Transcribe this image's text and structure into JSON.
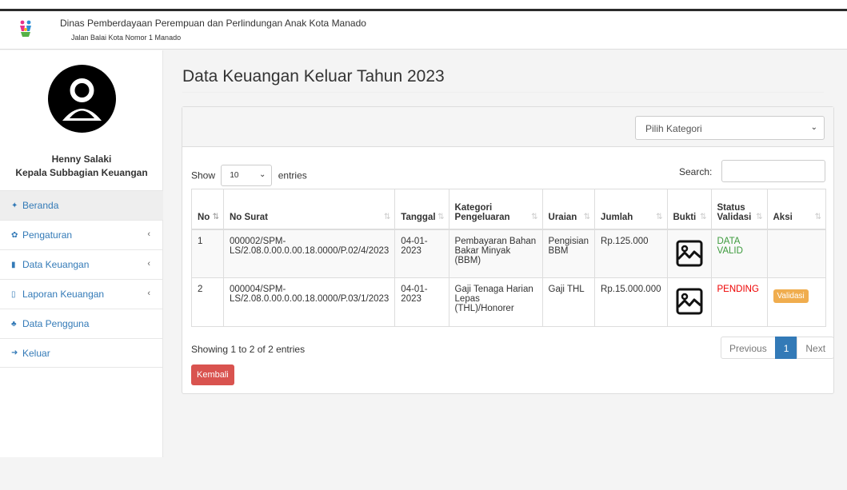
{
  "header": {
    "org_name": "Dinas Pemberdayaan Perempuan dan Perlindungan Anak Kota Manado",
    "org_address": "Jalan Balai Kota Nomor 1 Manado",
    "logo_icon": "dp3a-logo-icon"
  },
  "sidebar": {
    "user_name": "Henny Salaki",
    "user_role": "Kepala Subbagian Keuangan",
    "avatar_icon": "user-avatar-icon",
    "items": [
      {
        "icon": "home-icon",
        "glyph": "✦",
        "label": "Beranda",
        "has_submenu": false
      },
      {
        "icon": "gear-icon",
        "glyph": "✿",
        "label": "Pengaturan",
        "has_submenu": true
      },
      {
        "icon": "file-icon",
        "glyph": "▮",
        "label": "Data Keuangan",
        "has_submenu": true
      },
      {
        "icon": "report-icon",
        "glyph": "▯",
        "label": "Laporan Keuangan",
        "has_submenu": true
      },
      {
        "icon": "add-user-icon",
        "glyph": "♣",
        "label": "Data Pengguna",
        "has_submenu": false
      },
      {
        "icon": "sign-out-icon",
        "glyph": "➜",
        "label": "Keluar",
        "has_submenu": false
      }
    ]
  },
  "main": {
    "title": "Data Keuangan Keluar Tahun 2023",
    "category_select": {
      "selected": "Pilih Kategori"
    },
    "length_menu": {
      "prefix": "Show",
      "value": "10",
      "suffix": "entries"
    },
    "search": {
      "label": "Search:",
      "value": ""
    },
    "table": {
      "headers": [
        "No",
        "No Surat",
        "Tanggal",
        "Kategori Pengeluaran",
        "Uraian",
        "Jumlah",
        "Bukti",
        "Status Validasi",
        "Aksi"
      ],
      "rows": [
        {
          "no": "1",
          "no_surat": "000002/SPM-LS/2.08.0.00.0.00.18.0000/P.02/4/2023",
          "tanggal": "04-01-2023",
          "kategori": "Pembayaran Bahan Bakar Minyak (BBM)",
          "uraian": "Pengisian BBM",
          "jumlah": "Rp.125.000",
          "bukti_icon": "image-icon",
          "status": "DATA VALID",
          "status_color": "#3c9a3c",
          "aksi": ""
        },
        {
          "no": "2",
          "no_surat": "000004/SPM-LS/2.08.0.00.0.00.18.0000/P.03/1/2023",
          "tanggal": "04-01-2023",
          "kategori": "Gaji Tenaga Harian Lepas (THL)/Honorer",
          "uraian": "Gaji THL",
          "jumlah": "Rp.15.000.000",
          "bukti_icon": "image-icon",
          "status": "PENDING",
          "status_color": "#ee0000",
          "aksi": "Validasi"
        }
      ]
    },
    "info": "Showing 1 to 2 of 2 entries",
    "pagination": {
      "previous": "Previous",
      "current": "1",
      "next": "Next"
    },
    "back_button": "Kembali"
  },
  "colors": {
    "link": "#337ab7",
    "danger": "#d9534f",
    "warning": "#f0ad4e",
    "primary": "#337ab7"
  }
}
